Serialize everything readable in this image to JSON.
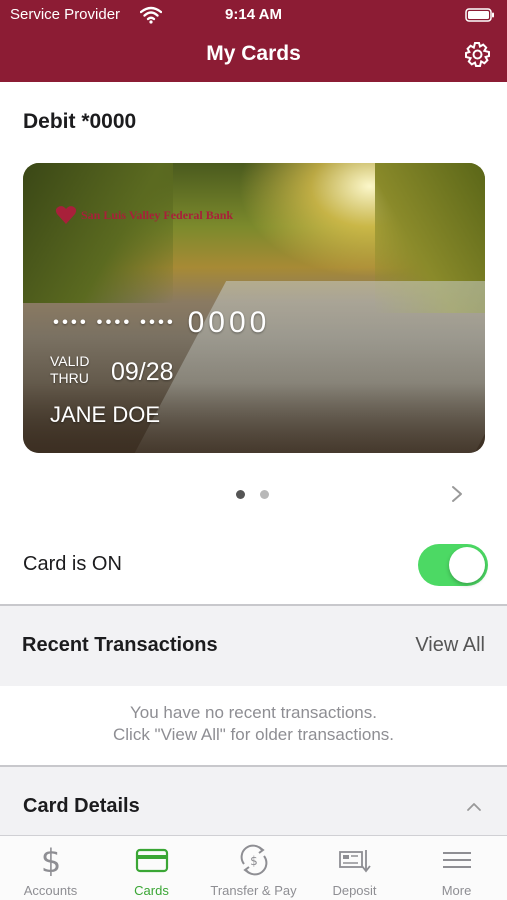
{
  "status_bar": {
    "carrier": "Service Provider",
    "time": "9:14 AM"
  },
  "nav": {
    "title": "My Cards",
    "settings_icon": "gear-icon"
  },
  "card": {
    "title": "Debit *0000",
    "bank_name": "San Luis Valley Federal Bank",
    "masked_number": "•••• •••• ••••",
    "last4": "0000",
    "valid_thru_label": "VALID THRU",
    "expiry": "09/28",
    "holder": "JANE DOE",
    "page_index": 1,
    "page_count": 2
  },
  "card_status": {
    "label": "Card is ON",
    "on": true,
    "accent": "#4cd964"
  },
  "recent": {
    "title": "Recent Transactions",
    "view_all": "View All",
    "empty_line1": "You have no recent transactions.",
    "empty_line2": "Click \"View All\" for older transactions."
  },
  "details": {
    "title": "Card Details",
    "expanded": true
  },
  "tabbar": {
    "items": [
      {
        "label": "Accounts",
        "icon": "dollar-icon",
        "active": false
      },
      {
        "label": "Cards",
        "icon": "card-icon",
        "active": true
      },
      {
        "label": "Transfer & Pay",
        "icon": "transfer-icon",
        "active": false
      },
      {
        "label": "Deposit",
        "icon": "deposit-check-icon",
        "active": false
      },
      {
        "label": "More",
        "icon": "menu-icon",
        "active": false
      }
    ]
  },
  "colors": {
    "brand": "#8c1c34",
    "active_tab": "#3aa635",
    "toggle_on": "#4cd964"
  }
}
